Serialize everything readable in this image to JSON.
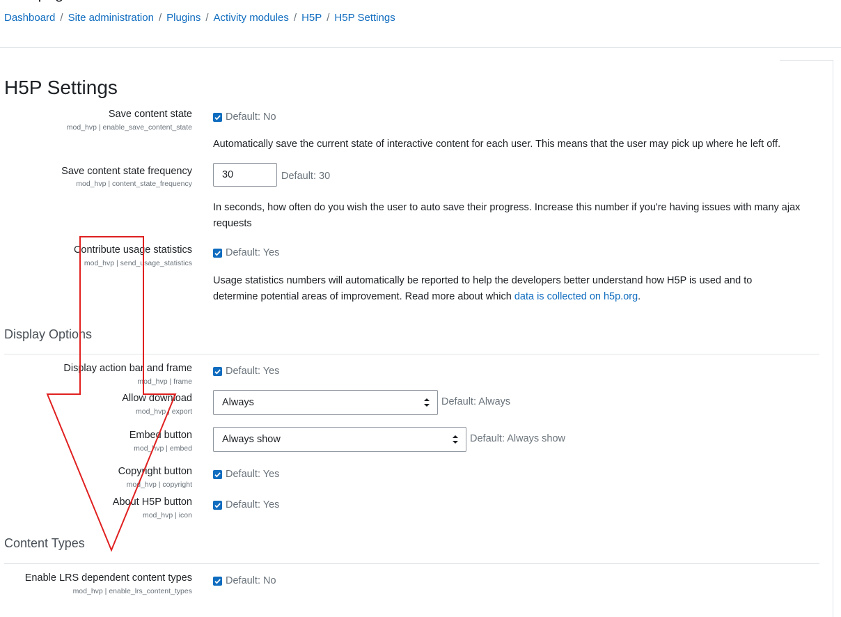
{
  "breadcrumb": [
    "Dashboard",
    "Site administration",
    "Plugins",
    "Activity modules",
    "H5P",
    "H5P Settings"
  ],
  "page": {
    "title": "H5P Settings"
  },
  "settings": {
    "save_state": {
      "label": "Save content state",
      "key": "mod_hvp | enable_save_content_state",
      "checked": true,
      "default": "Default: No",
      "desc": "Automatically save the current state of interactive content for each user. This means that the user may pick up where he left off."
    },
    "save_freq": {
      "label": "Save content state frequency",
      "key": "mod_hvp | content_state_frequency",
      "value": "30",
      "default": "Default: 30",
      "desc": "In seconds, how often do you wish the user to auto save their progress. Increase this number if you're having issues with many ajax requests"
    },
    "usage_stats": {
      "label": "Contribute usage statistics",
      "key": "mod_hvp | send_usage_statistics",
      "checked": true,
      "default": "Default: Yes",
      "desc": "Usage statistics numbers will automatically be reported to help the developers better understand how H5P is used and to determine potential areas of improvement. Read more about which",
      "link": "data is collected on h5p.org",
      "after_link": "."
    }
  },
  "display": {
    "heading": "Display Options",
    "frame": {
      "label": "Display action bar and frame",
      "key": "mod_hvp | frame",
      "checked": true,
      "default": "Default: Yes"
    },
    "export": {
      "label": "Allow download",
      "key": "mod_hvp | export",
      "selected": "Always",
      "default": "Default: Always"
    },
    "embed": {
      "label": "Embed button",
      "key": "mod_hvp | embed",
      "selected": "Always show",
      "default": "Default: Always show"
    },
    "copyright": {
      "label": "Copyright button",
      "key": "mod_hvp | copyright",
      "checked": true,
      "default": "Default: Yes"
    },
    "icon": {
      "label": "About H5P button",
      "key": "mod_hvp | icon",
      "checked": true,
      "default": "Default: Yes"
    }
  },
  "content_types": {
    "heading": "Content Types",
    "lrs": {
      "label": "Enable LRS dependent content types",
      "key": "mod_hvp | enable_lrs_content_types",
      "checked": true,
      "default": "Default: No"
    }
  },
  "colors": {
    "link": "#0f6cbf",
    "checkbox": "#0f6cbf",
    "annotation": "#e02020"
  }
}
